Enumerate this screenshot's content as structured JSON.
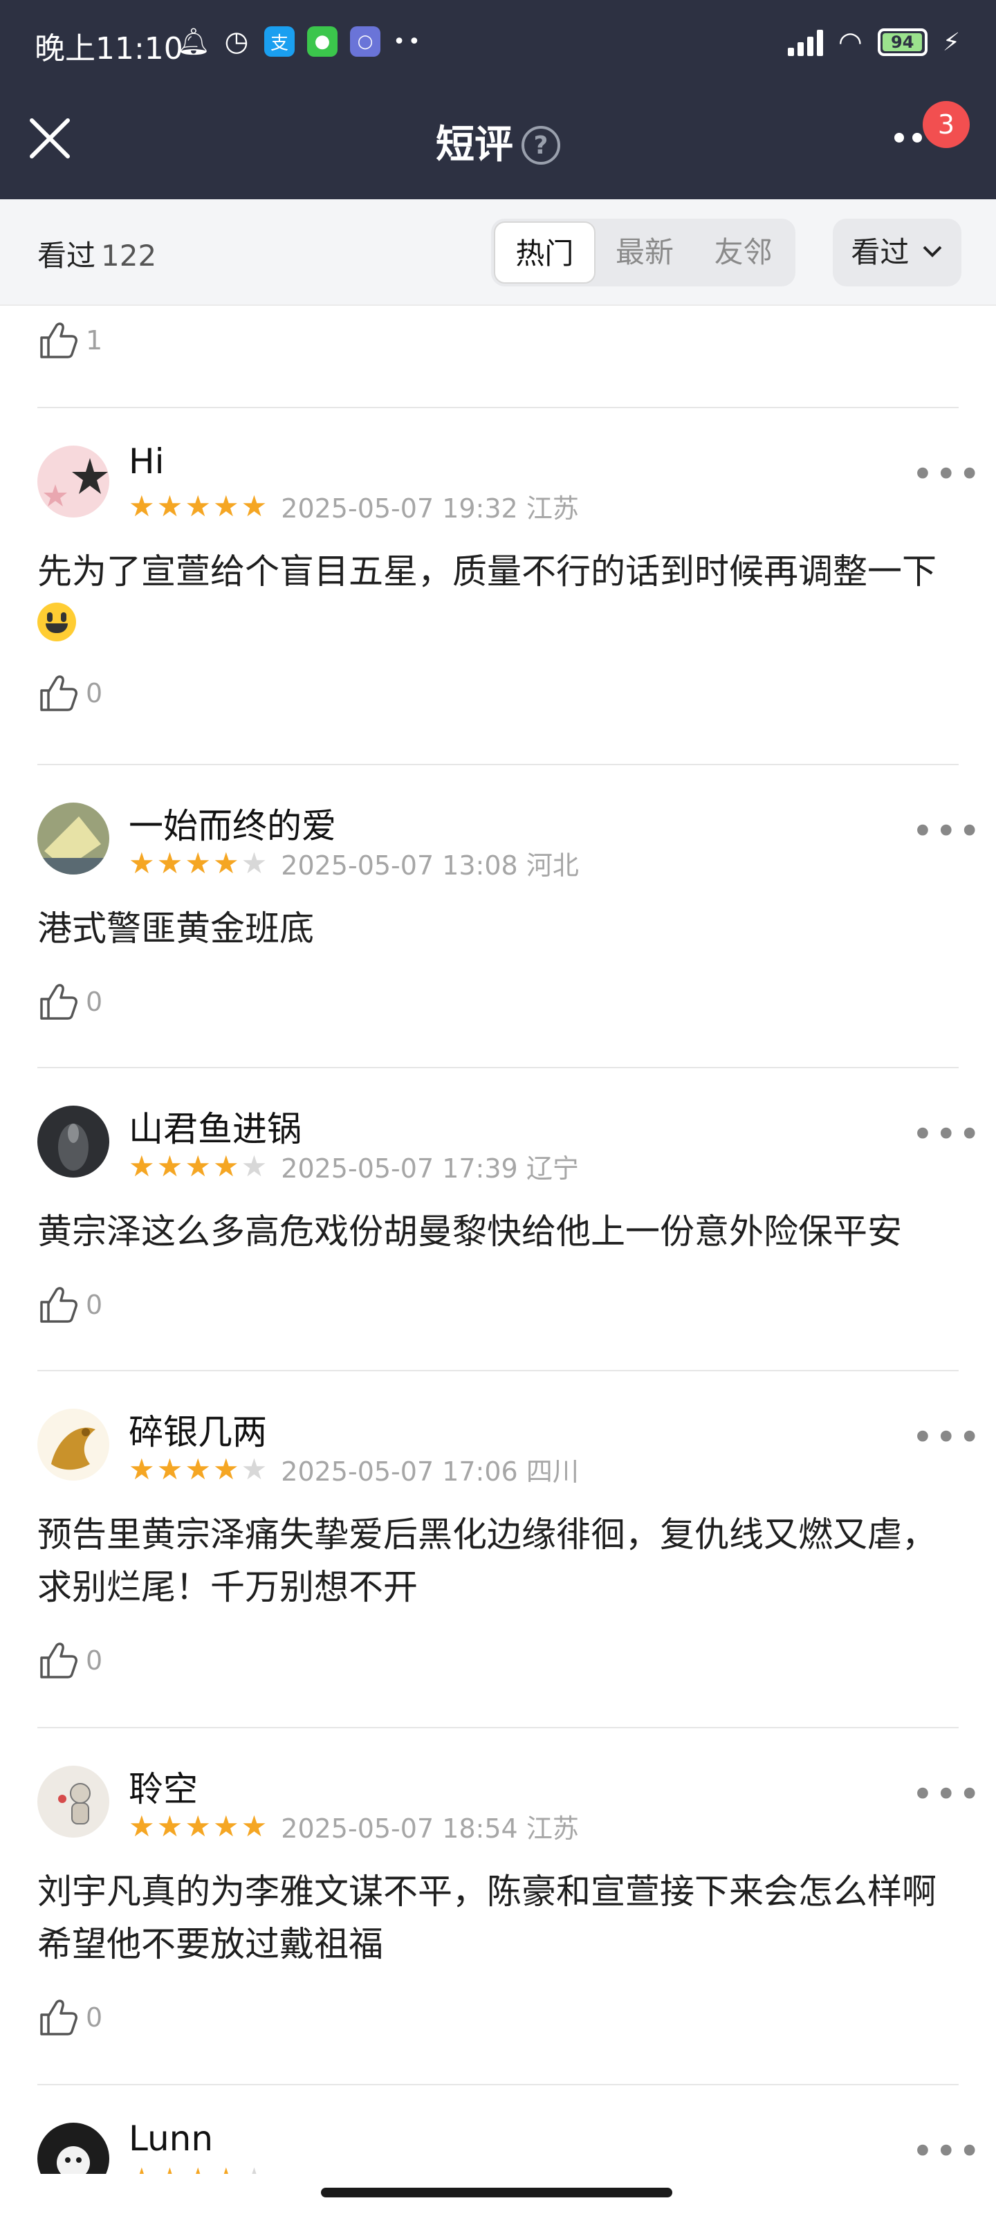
{
  "status_bar": {
    "time": "晚上11:10",
    "battery": "94",
    "icons": [
      "bell-icon",
      "timer-icon",
      "alipay-icon",
      "wechat-icon",
      "app-icon",
      "more-dots-icon",
      "signal-icon",
      "wifi-icon",
      "battery-icon",
      "charging-icon"
    ]
  },
  "header": {
    "title": "短评",
    "help": "?",
    "badge": "3",
    "close_icon": "close-icon",
    "more_icon": "more-icon"
  },
  "filter_bar": {
    "watched_label": "看过",
    "watched_count": "122",
    "tabs": [
      {
        "label": "热门",
        "active": true
      },
      {
        "label": "最新",
        "active": false
      },
      {
        "label": "友邻",
        "active": false
      }
    ],
    "dropdown_label": "看过"
  },
  "previous_likes": "1",
  "reviews": [
    {
      "user": "Hi",
      "rating": 5,
      "date": "2025-05-07 19:32",
      "region": "江苏",
      "content": "先为了宣萱给个盲目五星，质量不行的话到时候再调整一下",
      "emoji": "grinning-face-emoji",
      "likes": "0"
    },
    {
      "user": "一始而终的爱",
      "rating": 4,
      "date": "2025-05-07 13:08",
      "region": "河北",
      "content": "港式警匪黄金班底",
      "likes": "0"
    },
    {
      "user": "山君鱼进锅",
      "rating": 4,
      "date": "2025-05-07 17:39",
      "region": "辽宁",
      "content": "黄宗泽这么多高危戏份胡曼黎快给他上一份意外险保平安",
      "likes": "0"
    },
    {
      "user": "碎银几两",
      "rating": 4,
      "date": "2025-05-07 17:06",
      "region": "四川",
      "content": "预告里黄宗泽痛失挚爱后黑化边缘徘徊，复仇线又燃又虐，求别烂尾！千万别想不开",
      "likes": "0"
    },
    {
      "user": "聆空",
      "rating": 5,
      "date": "2025-05-07 18:54",
      "region": "江苏",
      "content": "刘宇凡真的为李雅文谋不平，陈豪和宣萱接下来会怎么样啊希望他不要放过戴祖福",
      "likes": "0"
    },
    {
      "user": "Lunn",
      "rating": 4,
      "date": "",
      "region": "",
      "content": "",
      "likes": ""
    }
  ],
  "colors": {
    "header_bg": "#2d3142",
    "star_on": "#f5a623",
    "star_off": "#d8d8d8",
    "badge": "#f24f50"
  }
}
